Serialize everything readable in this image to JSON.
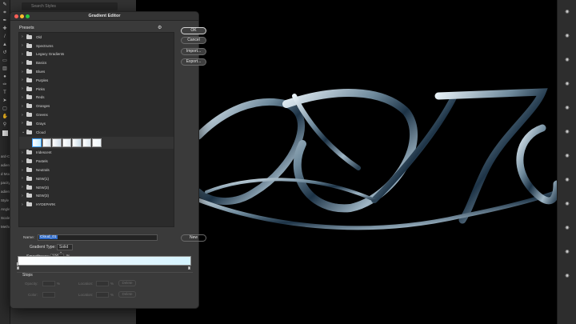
{
  "search": {
    "placeholder": "Search Styles"
  },
  "side_labels": [
    "ard-Ce",
    "adient",
    "d Mode",
    "pacity",
    "adient",
    "Style",
    "Angle",
    "Scale",
    "Method"
  ],
  "dialog": {
    "title": "Gradient Editor",
    "presets_label": "Presets",
    "buttons": {
      "ok": "OK",
      "cancel": "Cancel",
      "import": "Import...",
      "export": "Export...",
      "new": "New"
    },
    "folders_top": [
      "Old",
      "Spectrums",
      "Legacy Gradients",
      "Basics",
      "Blues",
      "Purples",
      "Pinks",
      "Reds",
      "Oranges",
      "Greens",
      "Grays"
    ],
    "open_folder": "Cloud",
    "folders_bottom": [
      "Iridescent",
      "Pastels",
      "Neutrals",
      "NEW(1)",
      "NEW(3)",
      "NEW(3)",
      "HYDEPARK"
    ],
    "swatch_count": 7,
    "swatch_colors": [
      "#bfeaff",
      "#d9e6ef",
      "#cfdde8",
      "#e3ecf2",
      "#c9dbe7",
      "#dde9f0",
      "#eef6fb"
    ],
    "name_label": "Name:",
    "name_value": "Cloud_01",
    "gradient_type_label": "Gradient Type:",
    "gradient_type_value": "Solid",
    "smoothness_label": "Smoothness:",
    "smoothness_value": "100",
    "smoothness_unit": "%",
    "stops_label": "Stops",
    "opacity_label": "Opacity:",
    "color_label": "Color:",
    "location_label": "Location:",
    "percent": "%",
    "delete_label": "Delete"
  }
}
